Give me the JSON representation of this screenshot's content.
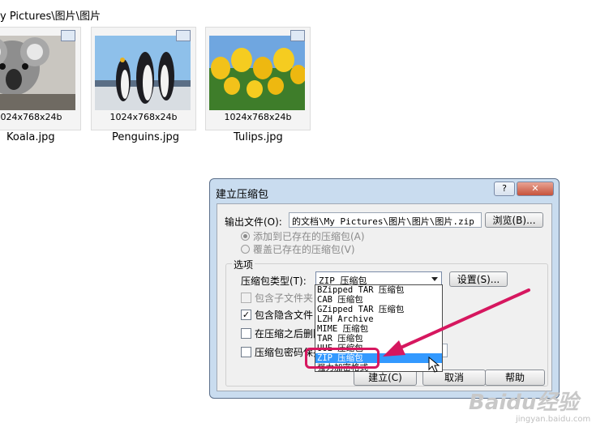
{
  "path_bar": {
    "text": "y Pictures\\图片\\图片"
  },
  "thumbnails": [
    {
      "dims": "1024x768x24b",
      "name": "Koala.jpg"
    },
    {
      "dims": "1024x768x24b",
      "name": "Penguins.jpg"
    },
    {
      "dims": "1024x768x24b",
      "name": "Tulips.jpg"
    }
  ],
  "dialog": {
    "title": "建立压缩包",
    "help_button": "?",
    "close_button": "✕",
    "output_label": "输出文件(O):",
    "output_value": "的文档\\My Pictures\\图片\\图片\\图片.zip",
    "browse_button": "浏览(B)...",
    "radio_add": "添加到已存在的压缩包(A)",
    "radio_overwrite": "覆盖已存在的压缩包(V)",
    "options_label": "选项",
    "type_label": "压缩包类型(T):",
    "type_value": "ZIP 压缩包",
    "settings_button": "设置(S)...",
    "checkbox_subfolders": "包含子文件夹",
    "checkbox_hidden": "包含隐含文件",
    "checkbox_delete": "在压缩之后删除",
    "checkbox_password": "压缩包密码保护",
    "ok_button": "建立(C)",
    "cancel_button": "取消",
    "help_btn": "帮助"
  },
  "dropdown": {
    "items": [
      "BZipped TAR 压缩包",
      "CAB 压缩包",
      "GZipped TAR 压缩包",
      "LZH Archive",
      "MIME 压缩包",
      "TAR 压缩包",
      "UUE 压缩包",
      "ZIP 压缩包",
      "强力加密格式"
    ],
    "selected_index": 7
  },
  "watermark": {
    "main": "Baidu经验",
    "sub": "jingyan.baidu.com"
  },
  "colors": {
    "highlight": "#d6175f",
    "selection": "#3399ff",
    "dialog_frame": "#c9dcef"
  }
}
